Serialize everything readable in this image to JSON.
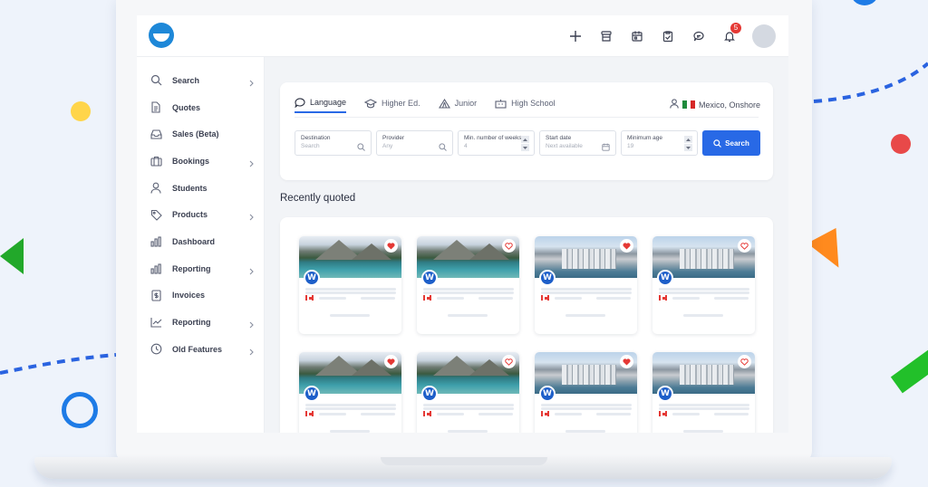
{
  "colors": {
    "accent": "#2869e6",
    "logo": "#1e88d8",
    "notification": "#e53935",
    "favorite": "#e53935"
  },
  "topbar": {
    "icons": [
      "plus-icon",
      "store-icon",
      "calendar-icon",
      "clipboard-check-icon",
      "chat-icon",
      "bell-icon"
    ],
    "notification_count": "5"
  },
  "sidebar": {
    "items": [
      {
        "label": "Search",
        "icon": "search-icon",
        "has_submenu": true
      },
      {
        "label": "Quotes",
        "icon": "document-icon",
        "has_submenu": false
      },
      {
        "label": "Sales (Beta)",
        "icon": "inbox-icon",
        "has_submenu": false
      },
      {
        "label": "Bookings",
        "icon": "briefcase-icon",
        "has_submenu": true
      },
      {
        "label": "Students",
        "icon": "user-icon",
        "has_submenu": false
      },
      {
        "label": "Products",
        "icon": "tag-icon",
        "has_submenu": true
      },
      {
        "label": "Dashboard",
        "icon": "bar-chart-icon",
        "has_submenu": false
      },
      {
        "label": "Reporting",
        "icon": "bar-chart-icon",
        "has_submenu": true
      },
      {
        "label": "Invoices",
        "icon": "invoice-icon",
        "has_submenu": false
      },
      {
        "label": "Reporting",
        "icon": "line-chart-icon",
        "has_submenu": true
      },
      {
        "label": "Old Features",
        "icon": "clock-icon",
        "has_submenu": true
      }
    ]
  },
  "search": {
    "tabs": [
      {
        "label": "Language",
        "icon": "chat-bubble-icon",
        "active": true
      },
      {
        "label": "Higher Ed.",
        "icon": "graduation-cap-icon",
        "active": false
      },
      {
        "label": "Junior",
        "icon": "tent-icon",
        "active": false
      },
      {
        "label": "High School",
        "icon": "school-icon",
        "active": false
      }
    ],
    "location": "Mexico, Onshore",
    "filters": [
      {
        "label": "Destination",
        "placeholder": "Search",
        "icon": "search-icon"
      },
      {
        "label": "Provider",
        "placeholder": "Any",
        "icon": "search-icon"
      },
      {
        "label": "Min. number of weeks",
        "placeholder": "4",
        "icon": "stepper"
      },
      {
        "label": "Start date",
        "placeholder": "Next available",
        "icon": "calendar-icon"
      },
      {
        "label": "Minimum age",
        "placeholder": "19",
        "icon": "stepper"
      }
    ],
    "button_label": "Search"
  },
  "recent": {
    "title": "Recently quoted",
    "cards": [
      {
        "image": "lake",
        "favorited": true
      },
      {
        "image": "lake",
        "favorited": false
      },
      {
        "image": "city",
        "favorited": true
      },
      {
        "image": "city",
        "favorited": false
      },
      {
        "image": "lake",
        "favorited": true
      },
      {
        "image": "lake",
        "favorited": false
      },
      {
        "image": "city",
        "favorited": true
      },
      {
        "image": "city",
        "favorited": false
      }
    ],
    "provider_initial": "W"
  }
}
